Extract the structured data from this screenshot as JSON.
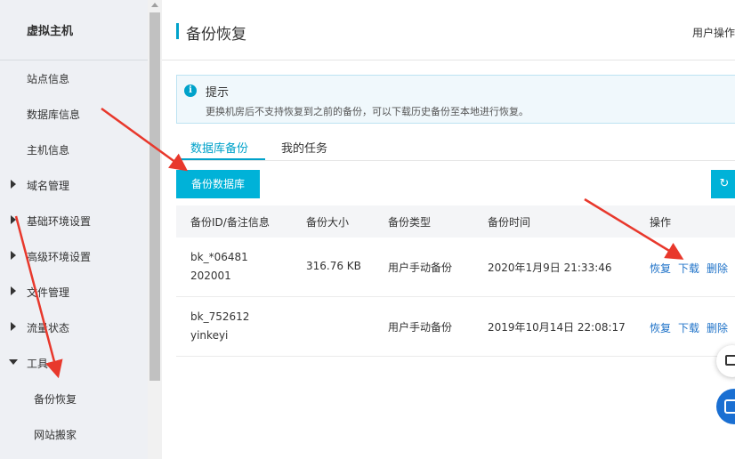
{
  "sidebar": {
    "title": "虚拟主机",
    "items": [
      {
        "label": "站点信息"
      },
      {
        "label": "数据库信息"
      },
      {
        "label": "主机信息"
      },
      {
        "label": "域名管理"
      },
      {
        "label": "基础环境设置"
      },
      {
        "label": "高级环境设置"
      },
      {
        "label": "文件管理"
      },
      {
        "label": "流量状态"
      },
      {
        "label": "工具"
      },
      {
        "label": "备份恢复"
      },
      {
        "label": "网站搬家"
      }
    ]
  },
  "header": {
    "title": "备份恢复",
    "right_link": "用户操作"
  },
  "notice": {
    "icon": "i",
    "title": "提示",
    "text": "更换机房后不支持恢复到之前的备份，可以下载历史备份至本地进行恢复。"
  },
  "tabs": [
    "数据库备份",
    "我的任务"
  ],
  "actions": {
    "backup_button": "备份数据库",
    "refresh_icon": "refresh-icon"
  },
  "table": {
    "columns": [
      "备份ID/备注信息",
      "备份大小",
      "备份类型",
      "备份时间",
      "操作"
    ],
    "rows": [
      {
        "id": "bk_*06481",
        "note": "202001",
        "size": "316.76 KB",
        "type": "用户手动备份",
        "time": "2020年1月9日 21:33:46",
        "ops": [
          "恢复",
          "下载",
          "删除"
        ]
      },
      {
        "id": "bk_752612",
        "note": "yinkeyi",
        "size": "",
        "type": "用户手动备份",
        "time": "2019年10月14日 22:08:17",
        "ops": [
          "恢复",
          "下载",
          "删除"
        ]
      }
    ]
  },
  "colors": {
    "accent": "#00a2ca",
    "button": "#00b2d8",
    "link": "#1e72c8",
    "annotation_arrow": "#e8382c"
  }
}
